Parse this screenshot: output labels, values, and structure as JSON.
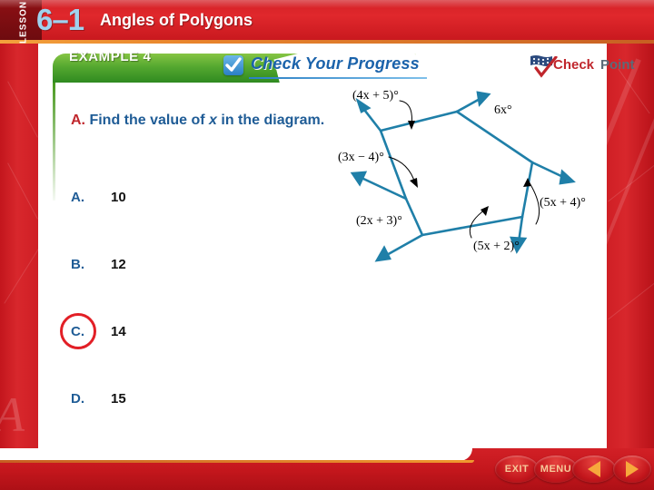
{
  "header": {
    "lesson_word": "LESSON",
    "lesson_number": "6–1",
    "title": "Angles of Polygons"
  },
  "example_banner": {
    "example_label": "EXAMPLE 4",
    "check_your_progress": "Check Your Progress",
    "check_icon": "checkmark-icon"
  },
  "checkpoint_logo": {
    "check_word": "Check",
    "point_word": "Point",
    "check_color": "#c0262c",
    "point_color": "#5c6b78",
    "flag_icon": "flag-stars-icon",
    "tick_icon": "red-check-icon"
  },
  "question": {
    "letter": "A.",
    "text_before_var": "Find the value of ",
    "variable": "x",
    "text_after_var": " in the diagram.",
    "letter_color": "#c0262c",
    "text_color": "#1f5c96"
  },
  "choices": [
    {
      "letter": "A.",
      "value": "10",
      "correct": false
    },
    {
      "letter": "B.",
      "value": "12",
      "correct": false
    },
    {
      "letter": "C.",
      "value": "14",
      "correct": true
    },
    {
      "letter": "D.",
      "value": "15",
      "correct": false
    }
  ],
  "correct_answer": {
    "letter": "C.",
    "ring_color": "#e21f26"
  },
  "diagram": {
    "title": "hexagon-exterior-angles-diagram",
    "shape": "hexagon",
    "stroke_color": "#1f7fa8",
    "label_color": "#000000",
    "angle_labels": [
      {
        "id": "angle-4x-plus-5",
        "text": "(4x + 5)°"
      },
      {
        "id": "angle-6x",
        "text": "6x°"
      },
      {
        "id": "angle-5x-plus-4",
        "text": "(5x + 4)°"
      },
      {
        "id": "angle-5x-plus-2",
        "text": "(5x + 2)°"
      },
      {
        "id": "angle-2x-plus-3",
        "text": "(2x + 3)°"
      },
      {
        "id": "angle-3x-minus-4",
        "text": "(3x − 4)°"
      }
    ]
  },
  "bottom_bar": {
    "exit_label": "EXIT",
    "menu_label": "MENU",
    "prev_icon": "triangle-left-icon",
    "next_icon": "triangle-right-icon"
  }
}
